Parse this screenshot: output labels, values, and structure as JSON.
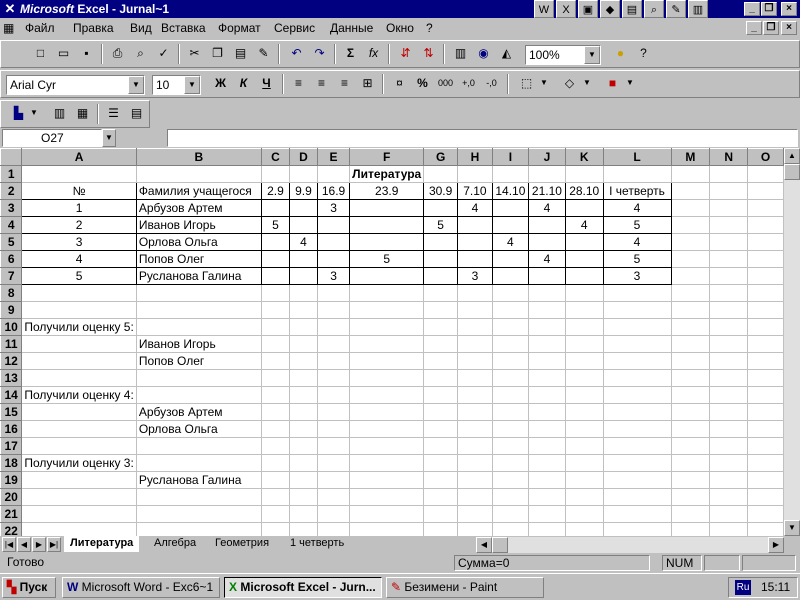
{
  "window": {
    "title_brand": "Microsoft",
    "title_rest": " Excel - Jurnal~1",
    "app_icon": "excel-x-icon"
  },
  "menu": {
    "items": [
      "Файл",
      "Правка",
      "Вид",
      "Вставка",
      "Формат",
      "Сервис",
      "Данные",
      "Окно",
      "?"
    ]
  },
  "toolbar": {
    "zoom": "100%",
    "font_name": "Arial Cyr",
    "font_size": "10",
    "bold": "Ж",
    "italic": "К",
    "underline": "Ч",
    "percent": "%",
    "thousands": "000",
    "sigma": "Σ",
    "fx": "fx"
  },
  "namebox": {
    "value": "O27"
  },
  "columns": [
    "A",
    "B",
    "C",
    "D",
    "E",
    "F",
    "G",
    "H",
    "I",
    "J",
    "K",
    "L",
    "M",
    "N",
    "O"
  ],
  "sheet": {
    "title": "Литература",
    "header": [
      "№",
      "Фамилия учащегося",
      "2.9",
      "9.9",
      "16.9",
      "23.9",
      "30.9",
      "7.10",
      "14.10",
      "21.10",
      "28.10",
      "I четверть"
    ],
    "rows": [
      [
        "1",
        "Арбузов Артем",
        "",
        "",
        "3",
        "",
        "",
        "4",
        "",
        "4",
        "",
        "4"
      ],
      [
        "2",
        "Иванов Игорь",
        "5",
        "",
        "",
        "",
        "5",
        "",
        "",
        "",
        "4",
        "5"
      ],
      [
        "3",
        "Орлова Ольга",
        "",
        "4",
        "",
        "",
        "",
        "",
        "4",
        "",
        "",
        "4"
      ],
      [
        "4",
        "Попов Олег",
        "",
        "",
        "",
        "5",
        "",
        "",
        "",
        "4",
        "",
        "5"
      ],
      [
        "5",
        "Русланова Галина",
        "",
        "",
        "3",
        "",
        "",
        "3",
        "",
        "",
        "",
        "3"
      ]
    ],
    "summary": {
      "label5": "Получили оценку 5:",
      "list5": [
        "Иванов Игорь",
        "Попов Олег"
      ],
      "label4": "Получили оценку 4:",
      "list4": [
        "Арбузов Артем",
        "Орлова Ольга"
      ],
      "label3": "Получили оценку 3:",
      "list3": [
        "Русланова Галина"
      ]
    }
  },
  "tabs": [
    "Литература",
    "Алгебра",
    "Геометрия",
    "1 четверть"
  ],
  "status": {
    "ready": "Готово",
    "sum": "Сумма=0",
    "num": "NUM"
  },
  "taskbar": {
    "start": "Пуск",
    "tasks": [
      "Microsoft Word - Exc6~1",
      "Microsoft Excel - Jurn...",
      "Безимени - Paint"
    ],
    "lang": "Ru",
    "clock": "15:11"
  },
  "colors": {
    "titlebar": "#000080",
    "face": "#c0c0c0"
  }
}
